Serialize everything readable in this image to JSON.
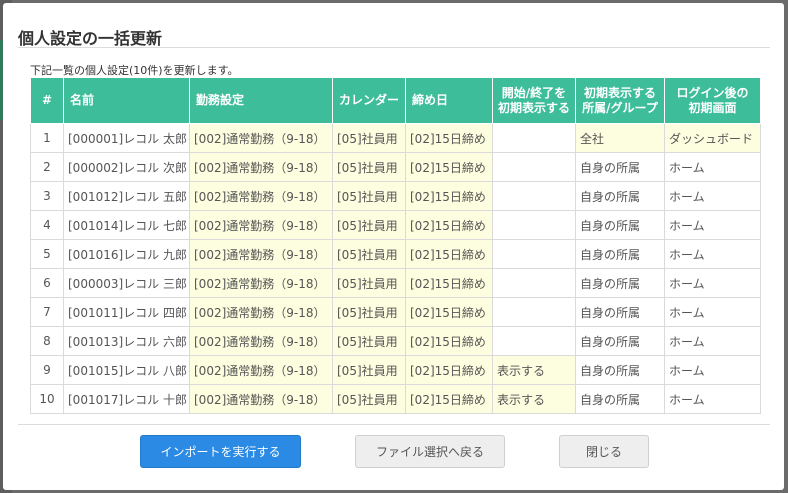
{
  "dialog": {
    "title": "個人設定の一括更新",
    "description": "下記一覧の個人設定(10件)を更新します。"
  },
  "table": {
    "headers": {
      "num": "#",
      "name": "名前",
      "work": "勤務設定",
      "calendar": "カレンダー",
      "cutoff": "締め日",
      "range_line1": "開始/終了を",
      "range_line2": "初期表示する",
      "scope_line1": "初期表示する",
      "scope_line2": "所属/グループ",
      "login_line1": "ログイン後の",
      "login_line2": "初期画面"
    },
    "rows": [
      {
        "num": "1",
        "name": "[000001]レコル 太郎",
        "work": "[002]通常勤務（9-18）",
        "calendar": "[05]社員用",
        "cutoff": "[02]15日締め",
        "range": "",
        "scope": "全社",
        "login": "ダッシュボード"
      },
      {
        "num": "2",
        "name": "[000002]レコル 次郎",
        "work": "[002]通常勤務（9-18）",
        "calendar": "[05]社員用",
        "cutoff": "[02]15日締め",
        "range": "",
        "scope": "自身の所属",
        "login": "ホーム"
      },
      {
        "num": "3",
        "name": "[001012]レコル 五郎",
        "work": "[002]通常勤務（9-18）",
        "calendar": "[05]社員用",
        "cutoff": "[02]15日締め",
        "range": "",
        "scope": "自身の所属",
        "login": "ホーム"
      },
      {
        "num": "4",
        "name": "[001014]レコル 七郎",
        "work": "[002]通常勤務（9-18）",
        "calendar": "[05]社員用",
        "cutoff": "[02]15日締め",
        "range": "",
        "scope": "自身の所属",
        "login": "ホーム"
      },
      {
        "num": "5",
        "name": "[001016]レコル 九郎",
        "work": "[002]通常勤務（9-18）",
        "calendar": "[05]社員用",
        "cutoff": "[02]15日締め",
        "range": "",
        "scope": "自身の所属",
        "login": "ホーム"
      },
      {
        "num": "6",
        "name": "[000003]レコル 三郎",
        "work": "[002]通常勤務（9-18）",
        "calendar": "[05]社員用",
        "cutoff": "[02]15日締め",
        "range": "",
        "scope": "自身の所属",
        "login": "ホーム"
      },
      {
        "num": "7",
        "name": "[001011]レコル 四郎",
        "work": "[002]通常勤務（9-18）",
        "calendar": "[05]社員用",
        "cutoff": "[02]15日締め",
        "range": "",
        "scope": "自身の所属",
        "login": "ホーム"
      },
      {
        "num": "8",
        "name": "[001013]レコル 六郎",
        "work": "[002]通常勤務（9-18）",
        "calendar": "[05]社員用",
        "cutoff": "[02]15日締め",
        "range": "",
        "scope": "自身の所属",
        "login": "ホーム"
      },
      {
        "num": "9",
        "name": "[001015]レコル 八郎",
        "work": "[002]通常勤務（9-18）",
        "calendar": "[05]社員用",
        "cutoff": "[02]15日締め",
        "range": "表示する",
        "scope": "自身の所属",
        "login": "ホーム"
      },
      {
        "num": "10",
        "name": "[001017]レコル 十郎",
        "work": "[002]通常勤務（9-18）",
        "calendar": "[05]社員用",
        "cutoff": "[02]15日締め",
        "range": "表示する",
        "scope": "自身の所属",
        "login": "ホーム"
      }
    ]
  },
  "buttons": {
    "import": "インポートを実行する",
    "back": "ファイル選択へ戻る",
    "close": "閉じる"
  },
  "colors": {
    "header_bg": "#3dbd9a",
    "highlight_cell": "#fdfde0",
    "primary_button": "#2b8ae3"
  }
}
